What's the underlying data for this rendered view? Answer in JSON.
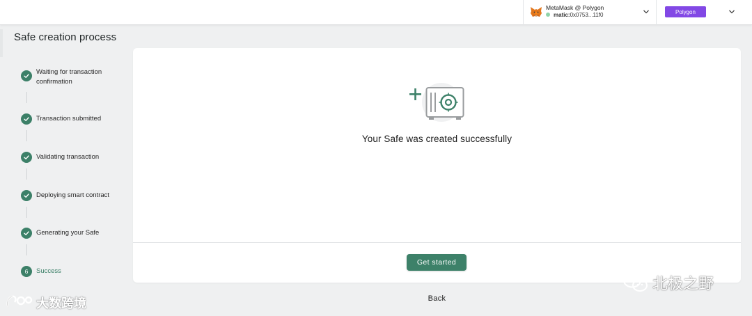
{
  "header": {
    "wallet_name": "MetaMask @ Polygon",
    "wallet_address_prefix": "matic:",
    "wallet_address": "0x0753...11f0",
    "network_label": "Polygon",
    "network_color": "#8248e5",
    "status_color": "#8fd3a9"
  },
  "page": {
    "title": "Safe creation process"
  },
  "steps": [
    {
      "label": "Waiting for transaction confirmation",
      "state": "done"
    },
    {
      "label": "Transaction submitted",
      "state": "done"
    },
    {
      "label": "Validating transaction",
      "state": "done"
    },
    {
      "label": "Deploying smart contract",
      "state": "done"
    },
    {
      "label": "Generating your Safe",
      "state": "done"
    },
    {
      "label": "Success",
      "number": "6",
      "state": "current"
    }
  ],
  "main": {
    "message": "Your Safe was created successfully",
    "primary_button": "Get started",
    "secondary_link": "Back"
  },
  "watermarks": {
    "left": "大数跨境",
    "right": "北极之野"
  },
  "colors": {
    "accent": "#3d8169",
    "background": "#eff0f1"
  },
  "icons": [
    "metamask-fox-icon",
    "chevron-down-icon",
    "checkmark-icon",
    "safe-vault-icon",
    "plus-icon"
  ]
}
